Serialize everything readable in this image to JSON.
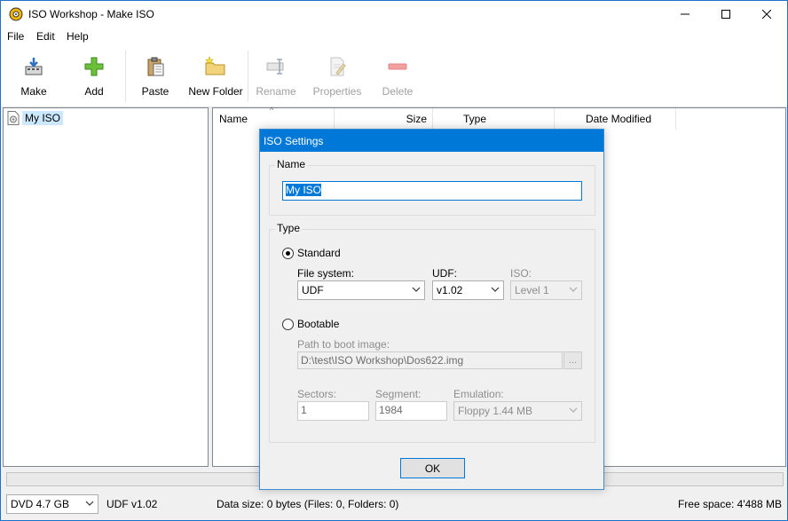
{
  "window": {
    "title": "ISO Workshop - Make ISO"
  },
  "menu": {
    "file": "File",
    "edit": "Edit",
    "help": "Help"
  },
  "toolbar": {
    "make": "Make",
    "add": "Add",
    "paste": "Paste",
    "new_folder": "New Folder",
    "rename": "Rename",
    "properties": "Properties",
    "delete": "Delete"
  },
  "tree": {
    "root": "My ISO"
  },
  "list": {
    "columns": {
      "name": "Name",
      "size": "Size",
      "type": "Type",
      "date_modified": "Date Modified"
    }
  },
  "status": {
    "disc_type": "DVD 4.7 GB",
    "format": "UDF v1.02",
    "data_size": "Data size: 0 bytes (Files: 0, Folders: 0)",
    "free_space": "Free space: 4'488 MB"
  },
  "dialog": {
    "title": "ISO Settings",
    "name_group": "Name",
    "name_value": "My ISO",
    "type_group": "Type",
    "standard_label": "Standard",
    "file_system_label": "File system:",
    "file_system_value": "UDF",
    "udf_label": "UDF:",
    "udf_value": "v1.02",
    "iso_label": "ISO:",
    "iso_value": "Level 1",
    "bootable_label": "Bootable",
    "boot_path_label": "Path to boot image:",
    "boot_path_value": "D:\\test\\ISO Workshop\\Dos622.img",
    "browse_label": "...",
    "sectors_label": "Sectors:",
    "sectors_value": "1",
    "segment_label": "Segment:",
    "segment_value": "1984",
    "emulation_label": "Emulation:",
    "emulation_value": "Floppy 1.44 MB",
    "ok_label": "OK"
  },
  "icons": {
    "app": "app-icon",
    "make": "make-icon",
    "add": "add-icon",
    "paste": "paste-icon",
    "new_folder": "new-folder-icon",
    "rename": "rename-icon",
    "properties": "properties-icon",
    "delete": "delete-icon",
    "iso_file": "iso-file-icon"
  },
  "colors": {
    "accent": "#0078d7",
    "selection": "#cce8ff",
    "add_green": "#5fb832",
    "delete_red": "#e05a5a"
  }
}
